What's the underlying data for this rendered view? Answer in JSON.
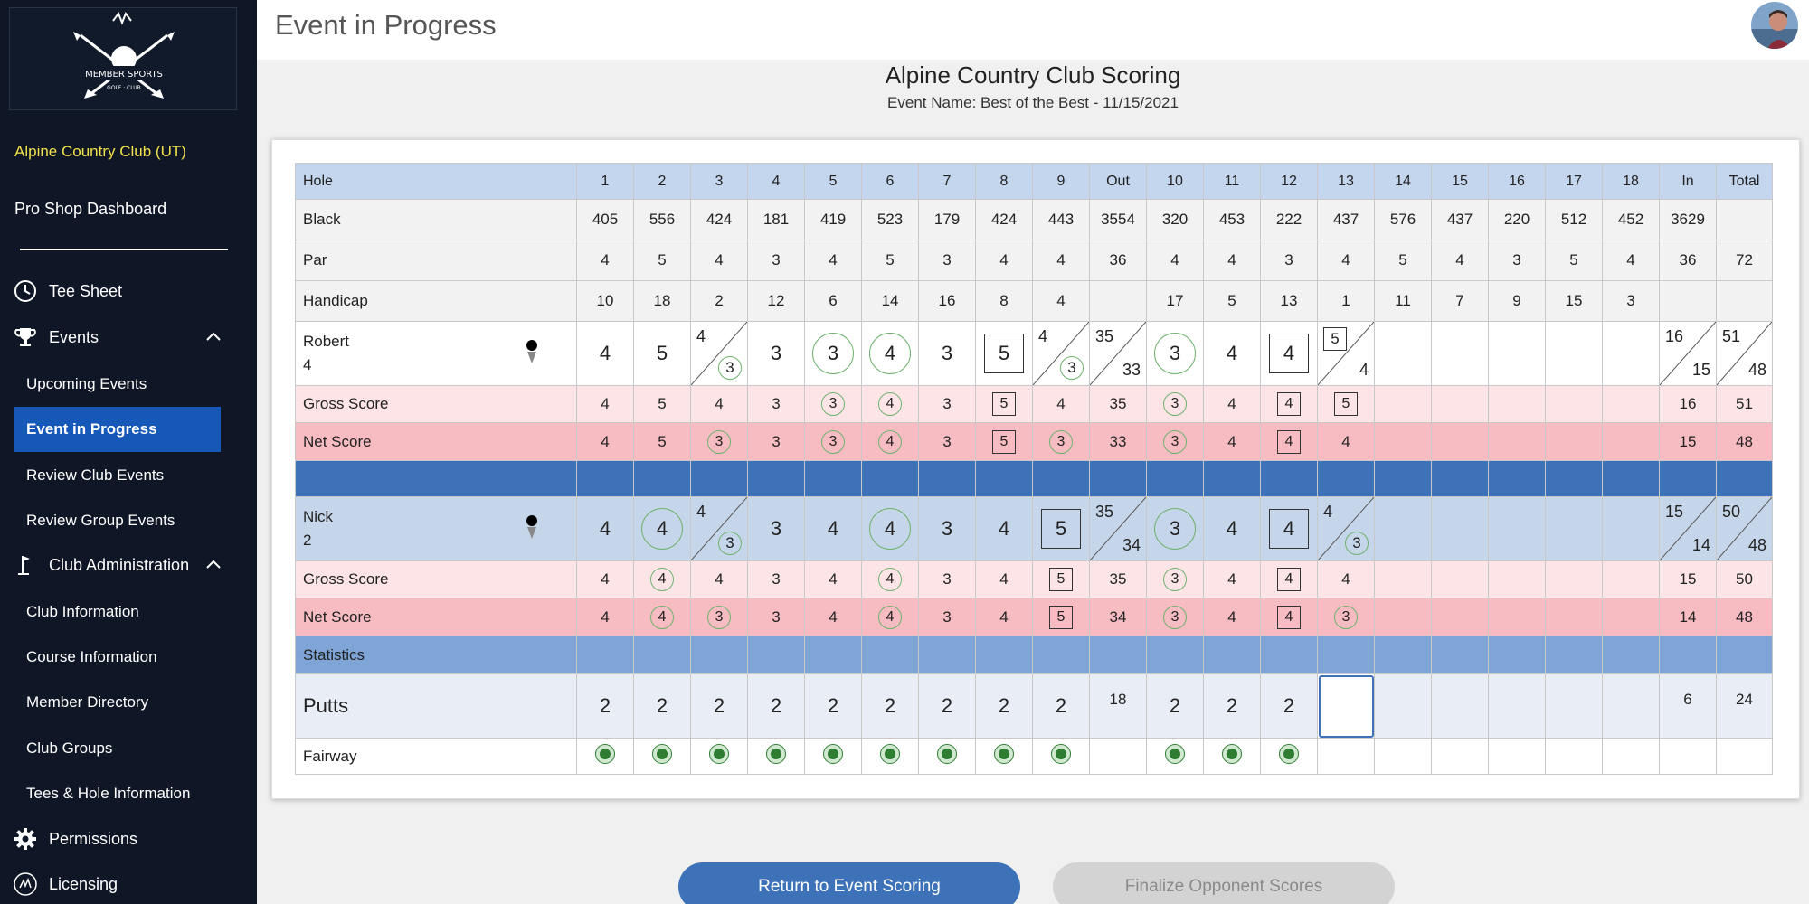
{
  "sidebar": {
    "club_name": "Alpine Country Club (UT)",
    "pro_shop": "Pro Shop Dashboard",
    "tee_sheet": "Tee Sheet",
    "events": "Events",
    "events_items": [
      "Upcoming Events",
      "Event in Progress",
      "Review Club Events",
      "Review Group Events"
    ],
    "club_admin": "Club Administration",
    "admin_items": [
      "Club Information",
      "Course Information",
      "Member Directory",
      "Club Groups",
      "Tees & Hole Information"
    ],
    "permissions": "Permissions",
    "licensing": "Licensing"
  },
  "header": {
    "title": "Event in Progress"
  },
  "scoring": {
    "title": "Alpine Country Club Scoring",
    "event_name": "Event Name: Best of the Best - 11/15/2021"
  },
  "table": {
    "hole_label": "Hole",
    "columns": [
      "1",
      "2",
      "3",
      "4",
      "5",
      "6",
      "7",
      "8",
      "9",
      "Out",
      "10",
      "11",
      "12",
      "13",
      "14",
      "15",
      "16",
      "17",
      "18",
      "In",
      "Total"
    ],
    "black": {
      "label": "Black",
      "values": [
        "405",
        "556",
        "424",
        "181",
        "419",
        "523",
        "179",
        "424",
        "443",
        "3554",
        "320",
        "453",
        "222",
        "437",
        "576",
        "437",
        "220",
        "512",
        "452",
        "3629",
        ""
      ]
    },
    "par": {
      "label": "Par",
      "values": [
        "4",
        "5",
        "4",
        "3",
        "4",
        "5",
        "3",
        "4",
        "4",
        "36",
        "4",
        "4",
        "3",
        "4",
        "5",
        "4",
        "3",
        "5",
        "4",
        "36",
        "72"
      ]
    },
    "handicap": {
      "label": "Handicap",
      "values": [
        "10",
        "18",
        "2",
        "12",
        "6",
        "14",
        "16",
        "8",
        "4",
        "",
        "17",
        "5",
        "13",
        "1",
        "11",
        "7",
        "9",
        "15",
        "3",
        "",
        ""
      ]
    },
    "gross_label": "Gross Score",
    "net_label": "Net Score",
    "stats_label": "Statistics",
    "putts": {
      "label": "Putts",
      "values": [
        "2",
        "2",
        "2",
        "2",
        "2",
        "2",
        "2",
        "2",
        "2",
        "18",
        "2",
        "2",
        "2",
        "",
        "",
        "",
        "",
        "",
        "",
        "6",
        "24"
      ]
    },
    "fairway": {
      "label": "Fairway",
      "hits": [
        true,
        true,
        true,
        true,
        true,
        true,
        true,
        true,
        true,
        false,
        true,
        true,
        true,
        false,
        false,
        false,
        false,
        false,
        false,
        false,
        false
      ]
    },
    "players": [
      {
        "name": "Robert",
        "handicap": "4",
        "gross": [
          "4",
          "5",
          "4",
          "3",
          "3",
          "4",
          "3",
          "5",
          "4",
          "35",
          "3",
          "4",
          "4",
          "5",
          "",
          "",
          "",
          "",
          "",
          "16",
          "51"
        ],
        "net": [
          "4",
          "5",
          "3",
          "3",
          "3",
          "4",
          "3",
          "5",
          "3",
          "33",
          "3",
          "4",
          "4",
          "4",
          "",
          "",
          "",
          "",
          "",
          "15",
          "48"
        ],
        "gross_marks": [
          "",
          "",
          "",
          "",
          "ring",
          "ring",
          "",
          "sq",
          "",
          "",
          "ring",
          "",
          "sq",
          "sq",
          "",
          "",
          "",
          "",
          "",
          "",
          ""
        ],
        "net_marks": [
          "",
          "",
          "ring",
          "",
          "ring",
          "ring",
          "",
          "sq",
          "ring",
          "",
          "ring",
          "",
          "sq",
          "",
          "",
          "",
          "",
          "",
          "",
          "",
          ""
        ]
      },
      {
        "name": "Nick",
        "handicap": "2",
        "gross": [
          "4",
          "4",
          "4",
          "3",
          "4",
          "4",
          "3",
          "4",
          "5",
          "35",
          "3",
          "4",
          "4",
          "4",
          "",
          "",
          "",
          "",
          "",
          "15",
          "50"
        ],
        "net": [
          "4",
          "4",
          "3",
          "3",
          "4",
          "4",
          "3",
          "4",
          "5",
          "34",
          "3",
          "4",
          "4",
          "3",
          "",
          "",
          "",
          "",
          "",
          "14",
          "48"
        ],
        "gross_marks": [
          "",
          "ring",
          "",
          "",
          "",
          "ring",
          "",
          "",
          "sq",
          "",
          "ring",
          "",
          "sq",
          "",
          "",
          "",
          "",
          "",
          "",
          "",
          ""
        ],
        "net_marks": [
          "",
          "ring",
          "ring",
          "",
          "",
          "ring",
          "",
          "",
          "sq",
          "",
          "ring",
          "",
          "sq",
          "ring",
          "",
          "",
          "",
          "",
          "",
          "",
          ""
        ]
      }
    ]
  },
  "buttons": {
    "return": "Return to Event Scoring",
    "finalize": "Finalize Opponent Scores"
  },
  "colors": {
    "sidebar_bg": "#0f1726",
    "active_nav": "#1658b8",
    "club_name": "#f1e04a",
    "header_row": "#c4d6ee",
    "gross_row": "#fde5e7",
    "net_row": "#f7bcc1",
    "separator": "#3d72b8",
    "statistics": "#7ea5d6",
    "birdie_ring": "#6fb26f",
    "fairway_dot": "#2e7d32"
  }
}
